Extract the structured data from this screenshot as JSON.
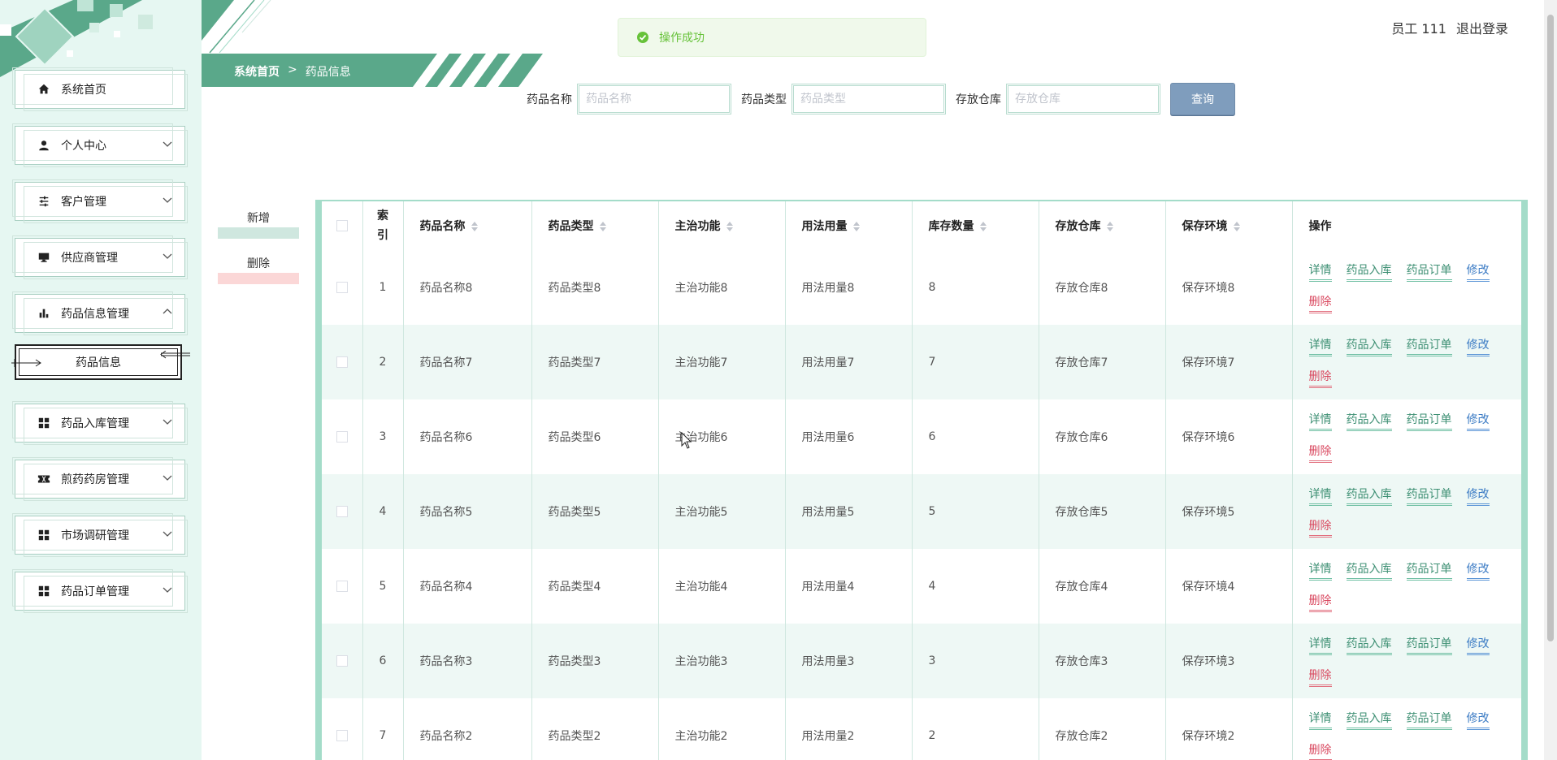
{
  "header": {
    "breadcrumb_home": "系统首页",
    "breadcrumb_sep": ">",
    "breadcrumb_current": "药品信息",
    "toast": "操作成功",
    "user_label": "员工 111",
    "logout": "退出登录"
  },
  "sidebar": {
    "items": [
      {
        "label": "系统首页",
        "icon": "home-icon"
      },
      {
        "label": "个人中心",
        "icon": "user-icon"
      },
      {
        "label": "客户管理",
        "icon": "sliders-icon"
      },
      {
        "label": "供应商管理",
        "icon": "monitor-icon"
      },
      {
        "label": "药品信息管理",
        "icon": "bar-chart-icon"
      },
      {
        "label": "药品入库管理",
        "icon": "grid-icon"
      },
      {
        "label": "煎药药房管理",
        "icon": "ticket-icon"
      },
      {
        "label": "市场调研管理",
        "icon": "grid-icon"
      },
      {
        "label": "药品订单管理",
        "icon": "grid-icon"
      }
    ],
    "submenu": {
      "label": "药品信息"
    }
  },
  "search": {
    "name_label": "药品名称",
    "name_placeholder": "药品名称",
    "type_label": "药品类型",
    "type_placeholder": "药品类型",
    "store_label": "存放仓库",
    "store_placeholder": "存放仓库",
    "query_button": "查询"
  },
  "actions": {
    "add": "新增",
    "delete": "删除"
  },
  "table": {
    "headers": {
      "index": "索引",
      "name": "药品名称",
      "type": "药品类型",
      "function": "主治功能",
      "usage": "用法用量",
      "stock": "库存数量",
      "store": "存放仓库",
      "env": "保存环境",
      "ops": "操作"
    },
    "op_labels": {
      "detail": "详情",
      "inbound": "药品入库",
      "order": "药品订单",
      "edit": "修改",
      "delete": "删除"
    },
    "rows": [
      {
        "index": "1",
        "name": "药品名称8",
        "type": "药品类型8",
        "function": "主治功能8",
        "usage": "用法用量8",
        "stock": "8",
        "store": "存放仓库8",
        "env": "保存环境8"
      },
      {
        "index": "2",
        "name": "药品名称7",
        "type": "药品类型7",
        "function": "主治功能7",
        "usage": "用法用量7",
        "stock": "7",
        "store": "存放仓库7",
        "env": "保存环境7"
      },
      {
        "index": "3",
        "name": "药品名称6",
        "type": "药品类型6",
        "function": "主治功能6",
        "usage": "用法用量6",
        "stock": "6",
        "store": "存放仓库6",
        "env": "保存环境6"
      },
      {
        "index": "4",
        "name": "药品名称5",
        "type": "药品类型5",
        "function": "主治功能5",
        "usage": "用法用量5",
        "stock": "5",
        "store": "存放仓库5",
        "env": "保存环境5"
      },
      {
        "index": "5",
        "name": "药品名称4",
        "type": "药品类型4",
        "function": "主治功能4",
        "usage": "用法用量4",
        "stock": "4",
        "store": "存放仓库4",
        "env": "保存环境4"
      },
      {
        "index": "6",
        "name": "药品名称3",
        "type": "药品类型3",
        "function": "主治功能3",
        "usage": "用法用量3",
        "stock": "3",
        "store": "存放仓库3",
        "env": "保存环境3"
      },
      {
        "index": "7",
        "name": "药品名称2",
        "type": "药品类型2",
        "function": "主治功能2",
        "usage": "用法用量2",
        "stock": "2",
        "store": "存放仓库2",
        "env": "保存环境2"
      }
    ]
  },
  "colors": {
    "accent": "#5aa88a",
    "sidebar_bg": "#e6f7f2",
    "query_button": "#7f9dbd",
    "delete_red": "#d9485f",
    "edit_blue": "#3b7bc4"
  }
}
